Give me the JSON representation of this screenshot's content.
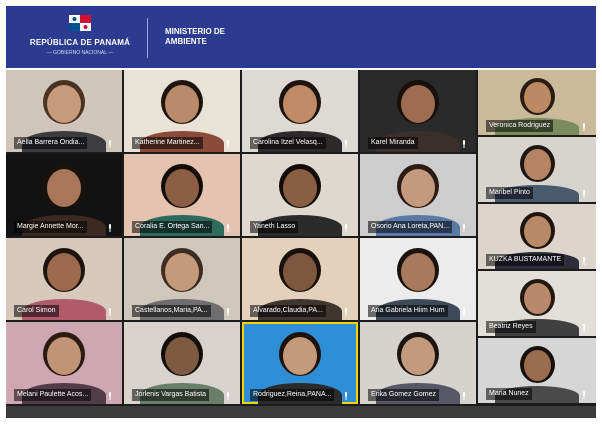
{
  "header": {
    "country": "REPÚBLICA DE PANAMÁ",
    "gov": "— GOBIERNO NACIONAL —",
    "ministry_line1": "MINISTERIO DE",
    "ministry_line2": "AMBIENTE"
  },
  "colors": {
    "header_bg": "#2c3a8f",
    "active_speaker": "#f3d400"
  },
  "participants": [
    {
      "name": "Aella Barrera Ondia...",
      "bg": "#cfc5b8",
      "skin": "#c79a7c",
      "hair": "#4a3222",
      "shirt": "#3b3b40"
    },
    {
      "name": "Katherine Martinez...",
      "bg": "#e9e2d6",
      "skin": "#b98b6a",
      "hair": "#1f1510",
      "shirt": "#8a4b3b"
    },
    {
      "name": "Carolina Itzel Velasq...",
      "bg": "#ddd9d3",
      "skin": "#c08a66",
      "hair": "#1c1410",
      "shirt": "#2f2a2a"
    },
    {
      "name": "Karel Miranda",
      "bg": "#2a2a2a",
      "skin": "#9e6d50",
      "hair": "#17100c",
      "shirt": "#3a2f2a"
    },
    {
      "name": "Veronica Rodriguez",
      "bg": "#cbb99b",
      "skin": "#bb8a63",
      "hair": "#2a1c12",
      "shirt": "#7a8c5e"
    },
    {
      "name": "Maribel Pinto",
      "bg": "#d7d3cf",
      "skin": "#b58563",
      "hair": "#1e1612",
      "shirt": "#4a5a6e"
    },
    {
      "name": "Margie Annette Mor...",
      "bg": "#121212",
      "skin": "#a8775a",
      "hair": "#1a120d",
      "shirt": "#3b2a22"
    },
    {
      "name": "Coralia E. Ortega San...",
      "bg": "#e4c3b1",
      "skin": "#8c5f44",
      "hair": "#120c08",
      "shirt": "#2e6b5c"
    },
    {
      "name": "Yaneth Lasso",
      "bg": "#ded8cf",
      "skin": "#8a5e43",
      "hair": "#120c08",
      "shirt": "#2b2b2b"
    },
    {
      "name": "Osorio Ana Loreta,PAN...",
      "bg": "#cdcdcd",
      "skin": "#c49a7e",
      "hair": "#2a1c14",
      "shirt": "#5a7aa6"
    },
    {
      "name": "KUZKA BUSTAMANTE",
      "bg": "#ddd5cb",
      "skin": "#b98a68",
      "hair": "#1f1510",
      "shirt": "#2e2e3a"
    },
    {
      "name": "Carol Simon",
      "bg": "#d9c9bb",
      "skin": "#9b6a4c",
      "hair": "#1d130e",
      "shirt": "#b15a6a"
    },
    {
      "name": "Castellanos,Maria,PA...",
      "bg": "#cfc7bc",
      "skin": "#c49a78",
      "hair": "#3c2c22",
      "shirt": "#6e6e6e"
    },
    {
      "name": "Alvarado,Claudia,PA...",
      "bg": "#e4d1bb",
      "skin": "#7d573e",
      "hair": "#17100c",
      "shirt": "#403630"
    },
    {
      "name": "Ana Gabriela Hiim Hum",
      "bg": "#ececec",
      "skin": "#a87a5b",
      "hair": "#1a120d",
      "shirt": "#3c4a5a"
    },
    {
      "name": "Beatriz Reyes",
      "bg": "#e2dfda",
      "skin": "#b8896a",
      "hair": "#241812",
      "shirt": "#404040"
    },
    {
      "name": "Melani Paulette Acos...",
      "bg": "#cfa7b2",
      "skin": "#c29476",
      "hair": "#2a1a12",
      "shirt": "#523c48"
    },
    {
      "name": "Jorlenis Vargas Batista",
      "bg": "#d8d4cd",
      "skin": "#7f5a42",
      "hair": "#130d0a",
      "shirt": "#6a7f6a"
    },
    {
      "name": "Rodriguez,Reina,PANA...",
      "bg": "#2f8fd6",
      "skin": "#c49a7b",
      "hair": "#1d130e",
      "shirt": "#2b2b2b"
    },
    {
      "name": "Erika Gomez Gomez",
      "bg": "#d6d2ce",
      "skin": "#c29a7d",
      "hair": "#1c1410",
      "shirt": "#575767"
    },
    {
      "name": "Maria Nunez",
      "bg": "#d6d6d6",
      "skin": "#9a6d50",
      "hair": "#17100c",
      "shirt": "#4a4a4a"
    }
  ]
}
